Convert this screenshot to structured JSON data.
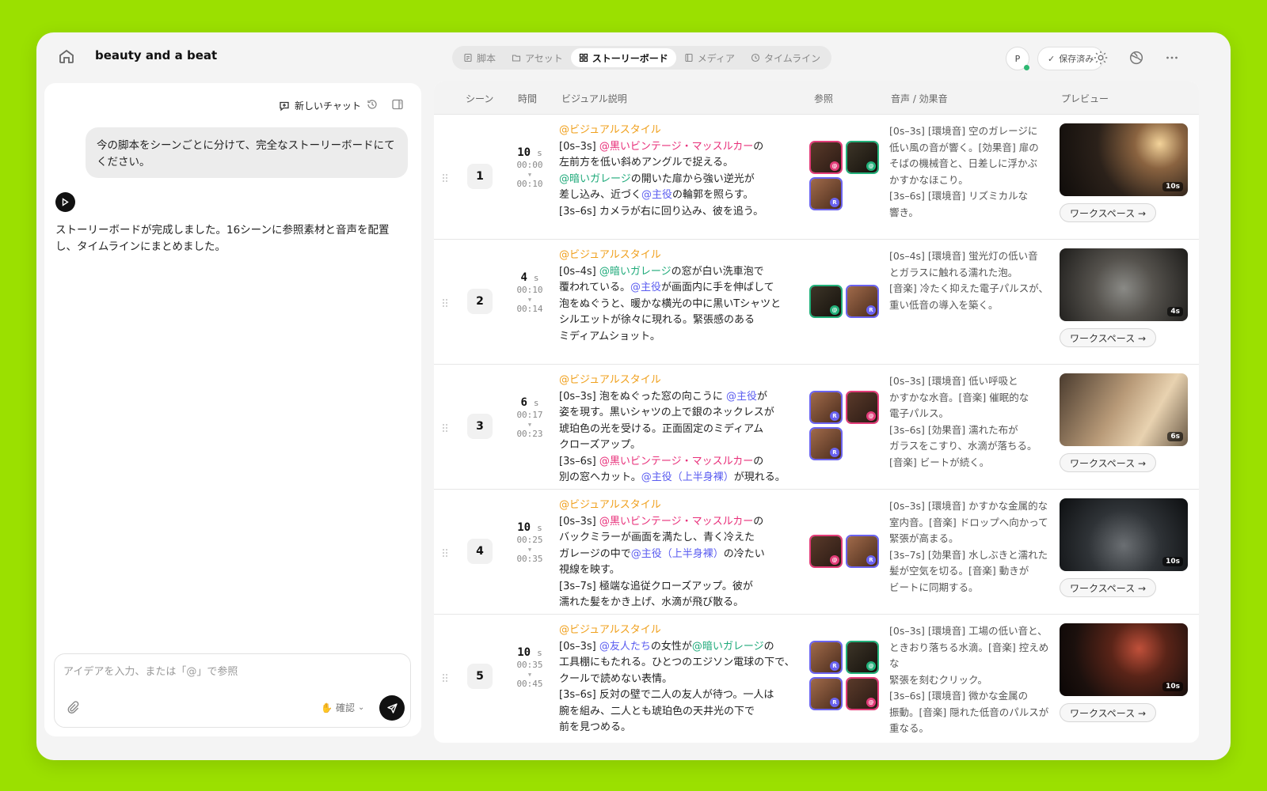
{
  "app": {
    "title": "beauty and a beat"
  },
  "tabs": [
    {
      "label": "脚本",
      "icon": "script-icon"
    },
    {
      "label": "アセット",
      "icon": "folder-icon"
    },
    {
      "label": "ストーリーボード",
      "icon": "grid-icon",
      "active": true
    },
    {
      "label": "メディア",
      "icon": "media-icon"
    },
    {
      "label": "タイムライン",
      "icon": "clock-icon"
    }
  ],
  "header": {
    "avatar_initial": "P",
    "saved_label": "保存済み"
  },
  "chat": {
    "new_chat_label": "新しいチャット",
    "user_message": "今の脚本をシーンごとに分けて、完全なストーリーボードにてください。",
    "bot_message": "ストーリーボードが完成しました。16シーンに参照素材と音声を配置し、タイムラインにまとめました。",
    "input_placeholder": "アイデアを入力、または「@」で参照",
    "confirm_label": "確認"
  },
  "table": {
    "headers": {
      "scene": "シーン",
      "time": "時間",
      "visual": "ビジュアル説明",
      "refs": "参照",
      "audio": "音声 / 効果音",
      "preview": "プレビュー"
    },
    "style_tag": "@ビジュアルスタイル",
    "workspace_label": "ワークスペース →",
    "unit": "s",
    "rows": [
      {
        "scene": "1",
        "duration": "10",
        "start": "00:00",
        "end": "00:10",
        "visual": [
          [
            {
              "t": "[0s–3s] ",
              "c": ""
            },
            {
              "t": "@黒いビンテージ・マッスルカー",
              "c": "m-car"
            },
            {
              "t": "の",
              "c": ""
            }
          ],
          [
            {
              "t": "左前方を低い斜めアングルで捉える。",
              "c": ""
            }
          ],
          [
            {
              "t": "@暗いガレージ",
              "c": "m-gar"
            },
            {
              "t": "の開いた扉から強い逆光が",
              "c": ""
            }
          ],
          [
            {
              "t": "差し込み、近づく",
              "c": ""
            },
            {
              "t": "@主役",
              "c": "m-hero"
            },
            {
              "t": "の輪郭を照らす。",
              "c": ""
            }
          ],
          [
            {
              "t": "[3s–6s] カメラが右に回り込み、彼を追う。",
              "c": ""
            }
          ]
        ],
        "audio": [
          "[0s–3s] [環境音] 空のガレージに",
          "低い風の音が響く。[効果音] 扉の",
          "そばの機械音と、日差しに浮かぶ",
          "かすかなほこり。",
          "[3s–6s] [環境音] リズミカルな",
          "響き。"
        ],
        "preview_duration": "10s"
      },
      {
        "scene": "2",
        "duration": "4",
        "start": "00:10",
        "end": "00:14",
        "visual": [
          [
            {
              "t": "[0s–4s] ",
              "c": ""
            },
            {
              "t": "@暗いガレージ",
              "c": "m-gar"
            },
            {
              "t": "の窓が白い洗車泡で",
              "c": ""
            }
          ],
          [
            {
              "t": "覆われている。",
              "c": ""
            },
            {
              "t": "@主役",
              "c": "m-hero"
            },
            {
              "t": "が画面内に手を伸ばして",
              "c": ""
            }
          ],
          [
            {
              "t": "泡をぬぐうと、暖かな横光の中に黒いTシャツと",
              "c": ""
            }
          ],
          [
            {
              "t": "シルエットが徐々に現れる。緊張感のある",
              "c": ""
            }
          ],
          [
            {
              "t": "ミディアムショット。",
              "c": ""
            }
          ]
        ],
        "audio": [
          "[0s–4s] [環境音] 蛍光灯の低い音",
          "とガラスに触れる濡れた泡。",
          "[音楽] 冷たく抑えた電子パルスが、",
          "重い低音の導入を築く。"
        ],
        "preview_duration": "4s"
      },
      {
        "scene": "3",
        "duration": "6",
        "start": "00:17",
        "end": "00:23",
        "visual": [
          [
            {
              "t": "[0s–3s] 泡をぬぐった窓の向こうに ",
              "c": ""
            },
            {
              "t": "@主役",
              "c": "m-hero"
            },
            {
              "t": "が",
              "c": ""
            }
          ],
          [
            {
              "t": "姿を現す。黒いシャツの上で銀のネックレスが",
              "c": ""
            }
          ],
          [
            {
              "t": "琥珀色の光を受ける。正面固定のミディアム",
              "c": ""
            }
          ],
          [
            {
              "t": "クローズアップ。",
              "c": ""
            }
          ],
          [
            {
              "t": "[3s–6s] ",
              "c": ""
            },
            {
              "t": "@黒いビンテージ・マッスルカー",
              "c": "m-car"
            },
            {
              "t": "の",
              "c": ""
            }
          ],
          [
            {
              "t": "別の窓へカット。",
              "c": ""
            },
            {
              "t": "@主役（上半身裸）",
              "c": "m-hero"
            },
            {
              "t": "が現れる。",
              "c": ""
            }
          ]
        ],
        "audio": [
          "[0s–3s] [環境音] 低い呼吸と",
          "かすかな水音。[音楽] 催眠的な",
          "電子パルス。",
          "[3s–6s] [効果音] 濡れた布が",
          "ガラスをこすり、水滴が落ちる。",
          "[音楽] ビートが続く。"
        ],
        "preview_duration": "6s"
      },
      {
        "scene": "4",
        "duration": "10",
        "start": "00:25",
        "end": "00:35",
        "visual": [
          [
            {
              "t": "[0s–3s] ",
              "c": ""
            },
            {
              "t": "@黒いビンテージ・マッスルカー",
              "c": "m-car"
            },
            {
              "t": "の",
              "c": ""
            }
          ],
          [
            {
              "t": "バックミラーが画面を満たし、青く冷えた",
              "c": ""
            }
          ],
          [
            {
              "t": "ガレージの中で",
              "c": ""
            },
            {
              "t": "@主役（上半身裸）",
              "c": "m-hero"
            },
            {
              "t": "の冷たい",
              "c": ""
            }
          ],
          [
            {
              "t": "視線を映す。",
              "c": ""
            }
          ],
          [
            {
              "t": "[3s–7s] 極端な追従クローズアップ。彼が",
              "c": ""
            }
          ],
          [
            {
              "t": "濡れた髪をかき上げ、水滴が飛び散る。",
              "c": ""
            }
          ]
        ],
        "audio": [
          "[0s–3s] [環境音] かすかな金属的な",
          "室内音。[音楽] ドロップへ向かって",
          "緊張が高まる。",
          "[3s–7s] [効果音] 水しぶきと濡れた",
          "髪が空気を切る。[音楽] 動きが",
          "ビートに同期する。"
        ],
        "preview_duration": "10s"
      },
      {
        "scene": "5",
        "duration": "10",
        "start": "00:35",
        "end": "00:45",
        "visual": [
          [
            {
              "t": "[0s–3s] ",
              "c": ""
            },
            {
              "t": "@友人たち",
              "c": "m-fr"
            },
            {
              "t": "の女性が",
              "c": ""
            },
            {
              "t": "@暗いガレージ",
              "c": "m-gar"
            },
            {
              "t": "の",
              "c": ""
            }
          ],
          [
            {
              "t": "工具棚にもたれる。ひとつのエジソン電球の下で、",
              "c": ""
            }
          ],
          [
            {
              "t": "クールで読めない表情。",
              "c": ""
            }
          ],
          [
            {
              "t": "[3s–6s] 反対の壁で二人の友人が待つ。一人は",
              "c": ""
            }
          ],
          [
            {
              "t": "腕を組み、二人とも琥珀色の天井光の下で",
              "c": ""
            }
          ],
          [
            {
              "t": "前を見つめる。",
              "c": ""
            }
          ]
        ],
        "audio": [
          "[0s–3s] [環境音] 工場の低い音と、",
          "ときおり落ちる水滴。[音楽] 控えめな",
          "緊張を刻むクリック。",
          "[3s–6s] [環境音] 微かな金属の",
          "振動。[音楽] 隠れた低音のパルスが",
          "重なる。"
        ],
        "preview_duration": "10s"
      }
    ]
  },
  "colors": {
    "car_mention": "#e8307a",
    "garage_mention": "#1faa7a",
    "hero_mention": "#5a5cf0",
    "style_tag": "#f0a01c",
    "background": "#9be000"
  }
}
